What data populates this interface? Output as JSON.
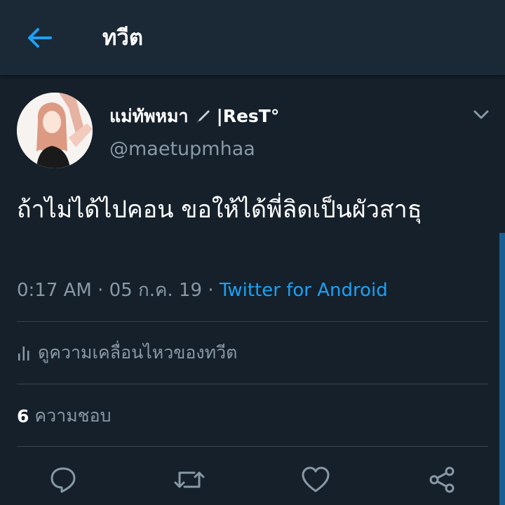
{
  "header": {
    "back_icon": "arrow-left-icon",
    "title": "ทวีต",
    "accent_color": "#1da1f2",
    "background_color": "#1b2836"
  },
  "tweet": {
    "author": {
      "display_name": "แม่ทัพหมา",
      "display_name_suffix": "|ResT°",
      "name_icon": "fountain-pen-icon",
      "handle": "@maetupmhaa"
    },
    "text": "ถ้าไม่ได้ไปคอน ขอให้ได้พี่ลิดเป็นผัวสาธุ",
    "time": "0:17 AM",
    "date": "05 ก.ค. 19",
    "separator": "·",
    "source": "Twitter for Android",
    "activity_label": "ดูความเคลื่อนไหวของทวีต",
    "activity_icon": "bar-chart-icon",
    "likes_count": "6",
    "likes_label": "ความชอบ"
  },
  "actions": [
    {
      "name": "reply",
      "icon": "speech-bubble-icon"
    },
    {
      "name": "retweet",
      "icon": "retweet-icon"
    },
    {
      "name": "like",
      "icon": "heart-icon"
    },
    {
      "name": "share",
      "icon": "share-icon"
    }
  ],
  "colors": {
    "background": "#15202b",
    "secondary_text": "#8899a6",
    "link": "#1da1f2",
    "divider": "#38444d"
  }
}
